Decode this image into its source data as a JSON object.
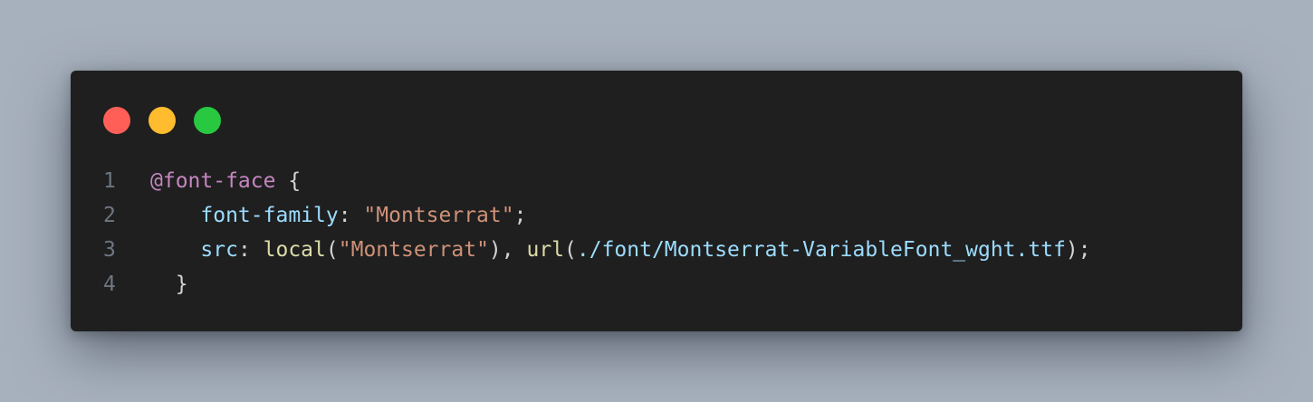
{
  "window": {
    "controls": [
      {
        "name": "close",
        "color": "#ff5f57"
      },
      {
        "name": "minimize",
        "color": "#febc2e"
      },
      {
        "name": "maximize",
        "color": "#28c840"
      }
    ]
  },
  "code": {
    "lines": [
      {
        "number": "1",
        "indent": "",
        "tokens": [
          {
            "text": "@font-face",
            "kind": "kw"
          },
          {
            "text": " {",
            "kind": "punc"
          }
        ]
      },
      {
        "number": "2",
        "indent": "    ",
        "tokens": [
          {
            "text": "font-family",
            "kind": "prop"
          },
          {
            "text": ": ",
            "kind": "punc"
          },
          {
            "text": "\"Montserrat\"",
            "kind": "str"
          },
          {
            "text": ";",
            "kind": "punc"
          }
        ]
      },
      {
        "number": "3",
        "indent": "    ",
        "tokens": [
          {
            "text": "src",
            "kind": "prop"
          },
          {
            "text": ": ",
            "kind": "punc"
          },
          {
            "text": "local",
            "kind": "fn"
          },
          {
            "text": "(",
            "kind": "punc"
          },
          {
            "text": "\"Montserrat\"",
            "kind": "str"
          },
          {
            "text": "), ",
            "kind": "punc"
          },
          {
            "text": "url",
            "kind": "fn"
          },
          {
            "text": "(",
            "kind": "punc"
          },
          {
            "text": "./font/Montserrat-VariableFont_wght.ttf",
            "kind": "url"
          },
          {
            "text": ");",
            "kind": "punc"
          }
        ]
      },
      {
        "number": "4",
        "indent": "  ",
        "tokens": [
          {
            "text": "}",
            "kind": "punc"
          }
        ]
      }
    ]
  }
}
